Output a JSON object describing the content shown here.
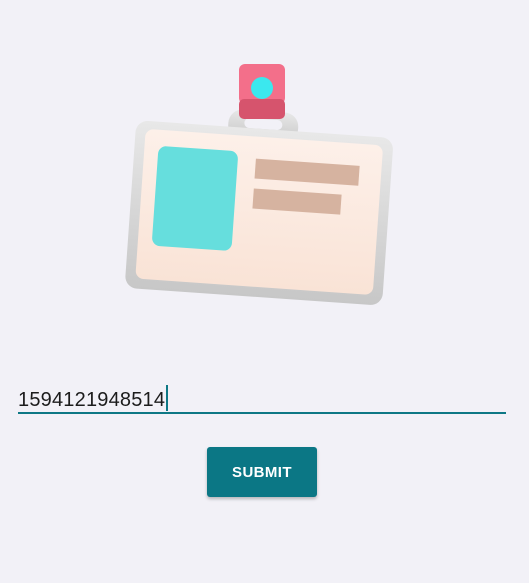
{
  "illustration": {
    "icon": "id-badge-icon",
    "colors": {
      "clip": "#f36f8a",
      "clip_dot": "#3be8ee",
      "card_frame": "#d8d8d8",
      "card_face": "#fbe9df",
      "photo": "#66dedd",
      "text_lines": "#d6b3a0"
    }
  },
  "form": {
    "id_input": {
      "value": "1594121948514",
      "accent_color": "#0e7885"
    },
    "submit_label": "SUBMIT",
    "submit_color": "#0b7785"
  }
}
